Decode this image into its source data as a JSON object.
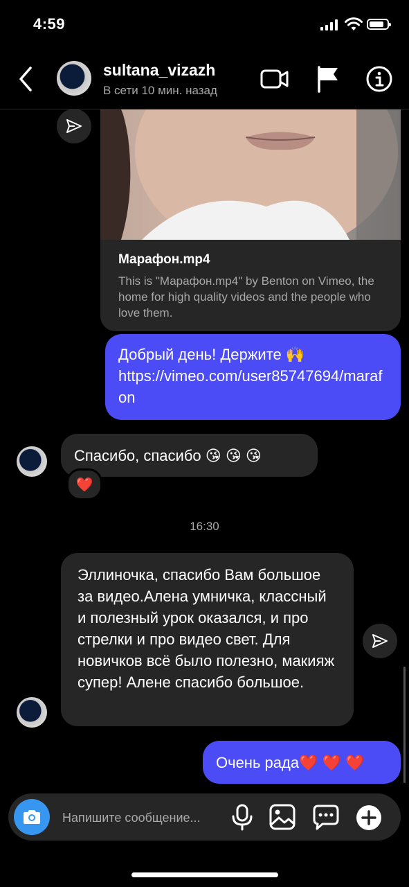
{
  "status_bar": {
    "time": "4:59"
  },
  "header": {
    "username": "sultana_vizazh",
    "presence": "В сети 10 мин. назад"
  },
  "link_preview": {
    "title": "Марафон.mp4",
    "description": "This is \"Марафон.mp4\" by Benton on Vimeo, the home for high quality videos and the people who love them."
  },
  "messages": {
    "out_1_text": "Добрый день! Держите 🙌",
    "out_1_link": "https://vimeo.com/user85747694/marafon",
    "in_1": "Спасибо, спасибо 😘 😘 😘",
    "in_1_reaction": "❤️",
    "timestamp": "16:30",
    "in_2": "Эллиночка, спасибо Вам большое за видео.Алена умничка, классный и полезный урок оказался, и про стрелки и про видео свет. Для новичков всё было полезно, макияж супер! Алене спасибо большое.",
    "out_2": "Очень рада❤️ ❤️ ❤️"
  },
  "composer": {
    "placeholder": "Напишите сообщение..."
  },
  "colors": {
    "outgoing_bubble": "#4b4cf6",
    "incoming_bubble": "#262626",
    "camera_button": "#3797f0"
  },
  "icons": {
    "back": "chevron-left-icon",
    "video": "video-camera-icon",
    "flag": "flag-icon",
    "info": "info-icon",
    "share": "paper-plane-icon",
    "camera": "camera-icon",
    "mic": "microphone-icon",
    "gallery": "image-icon",
    "sticker": "chat-bubble-icon",
    "plus": "plus-circle-icon"
  }
}
